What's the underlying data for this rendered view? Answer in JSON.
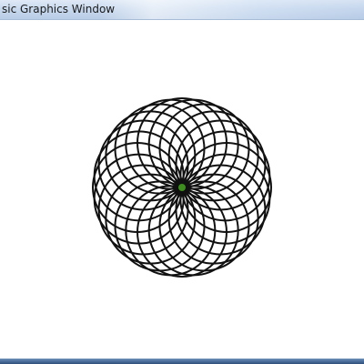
{
  "window": {
    "title": "sic Graphics Window"
  },
  "drawing": {
    "description": "rosette of overlapping circles",
    "circle_count": 24,
    "stroke_color": "#111111",
    "center_marker_color": "#3e8e1f"
  },
  "colors": {
    "background": "#ffffff",
    "titlebar": "#c8d9ee",
    "bottom_border": "#4c6f9b"
  }
}
